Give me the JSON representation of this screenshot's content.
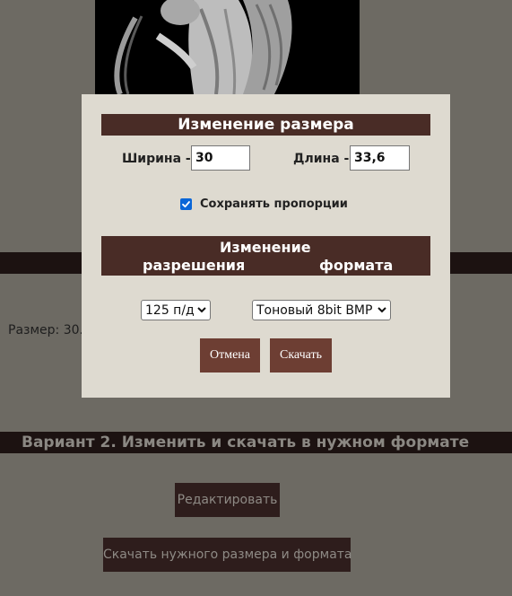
{
  "background": {
    "size_text": "Размер: 30.0",
    "variant2_title": "Вариант 2. Изменить и скачать в нужном формате",
    "edit_button": "Редактировать",
    "download_button": "Скачать нужного размера и формата"
  },
  "modal": {
    "resize_title": "Изменение размера",
    "width_label": "Ширина -",
    "width_value": "30",
    "length_label": "Длина -",
    "length_value": "33,6",
    "keep_proportions_label": "Сохранять пропорции",
    "keep_proportions_checked": true,
    "change_label": "Изменение",
    "resolution_label": "разрешения",
    "format_label": "формата",
    "resolution_selected": "125 п/д",
    "format_selected": "Тоновый 8bit BMP",
    "cancel_button": "Отмена",
    "download_button": "Скачать"
  },
  "colors": {
    "modal_header": "#492c26",
    "modal_button": "#6d3e33",
    "modal_background": "#dedad0",
    "overlay_background": "#6d6a63",
    "checkbox": "#0a66d8"
  },
  "icons": {
    "checkbox": "checkmark-icon",
    "select_arrow": "chevron-down-icon"
  }
}
